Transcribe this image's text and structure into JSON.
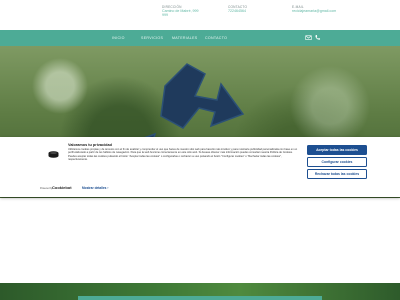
{
  "topbar": {
    "address": {
      "title": "Dirección",
      "lines": [
        "Camino de Mabré, 999",
        "999"
      ]
    },
    "phone": {
      "title": "Contacto",
      "value": "722464564"
    },
    "email": {
      "title": "E-Mail",
      "value": "reciclajeamaria@gmail.com"
    }
  },
  "nav": {
    "items": [
      "Inicio",
      "Servicios",
      "Materiales",
      "Contacto"
    ],
    "icons": [
      "mail-icon",
      "phone-icon"
    ]
  },
  "cookie": {
    "title": "Valoramos tu privacidad",
    "text": "Utilizamos cookies propias y de terceros con el fin de analizar y comprender el uso que haces de nuestro sitio web para hacerlo más intuitivo y para mostrarte publicidad personalizada con base en un perfil elaborado a partir de tus hábitos de navegación. Para que la web funcione correctamente en este sitio web. Si deseas obtener más información puedes consultar nuestra Política de Cookies. Puedes aceptar todas las cookies pulsando el botón \"Aceptar todas las cookies\" o configurarlas o rechazar su uso pulsando el botón \"Configurar cookies\" o \"Rechazar todas las cookies\", respectivamente.",
    "accept_all": "Aceptar todas las cookies",
    "configure": "Configurar cookies",
    "reject_all": "Rechazar todas las cookies",
    "powered_by": "Powered by",
    "brand": "Cookiebot",
    "show_details": "Mostrar detalles"
  },
  "colors": {
    "accent": "#4dab96",
    "cookie_button": "#1d4f91",
    "recycle_fill": "#1f3a5c"
  }
}
